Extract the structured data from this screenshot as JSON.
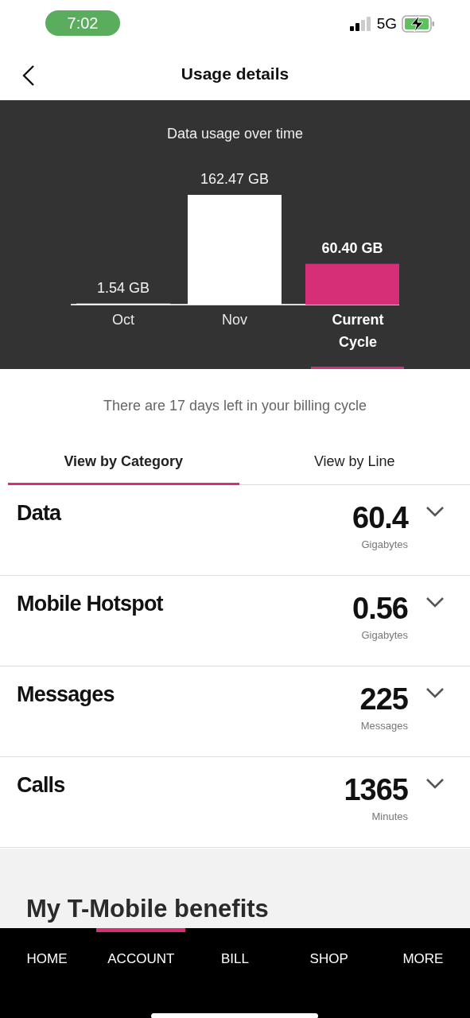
{
  "status_bar": {
    "time": "7:02",
    "network": "5G"
  },
  "header": {
    "title": "Usage details"
  },
  "usage_chart": {
    "chart_data": {
      "type": "bar",
      "title": "Data usage over time",
      "categories": [
        "Oct",
        "Nov",
        "Current Cycle"
      ],
      "values": [
        1.54,
        162.47,
        60.4
      ],
      "value_labels": [
        "1.54 GB",
        "162.47 GB",
        "60.40 GB"
      ]
    },
    "periods": [
      {
        "selected": false
      },
      {
        "selected": false
      },
      {
        "selected": true
      }
    ]
  },
  "billing_note": "There are 17 days left in your billing cycle",
  "tabs": [
    {
      "label": "View by Category",
      "selected": true
    },
    {
      "label": "View by Line",
      "selected": false
    }
  ],
  "categories": [
    {
      "name": "Data",
      "value": "60.4",
      "unit": "Gigabytes"
    },
    {
      "name": "Mobile Hotspot",
      "value": "0.56",
      "unit": "Gigabytes"
    },
    {
      "name": "Messages",
      "value": "225",
      "unit": "Messages"
    },
    {
      "name": "Calls",
      "value": "1365",
      "unit": "Minutes"
    }
  ],
  "benefits": {
    "title": "My T-Mobile benefits"
  },
  "bottom_nav": [
    {
      "label": "HOME",
      "selected": false
    },
    {
      "label": "ACCOUNT",
      "selected": true
    },
    {
      "label": "BILL",
      "selected": false
    },
    {
      "label": "SHOP",
      "selected": false
    },
    {
      "label": "MORE",
      "selected": false
    }
  ]
}
